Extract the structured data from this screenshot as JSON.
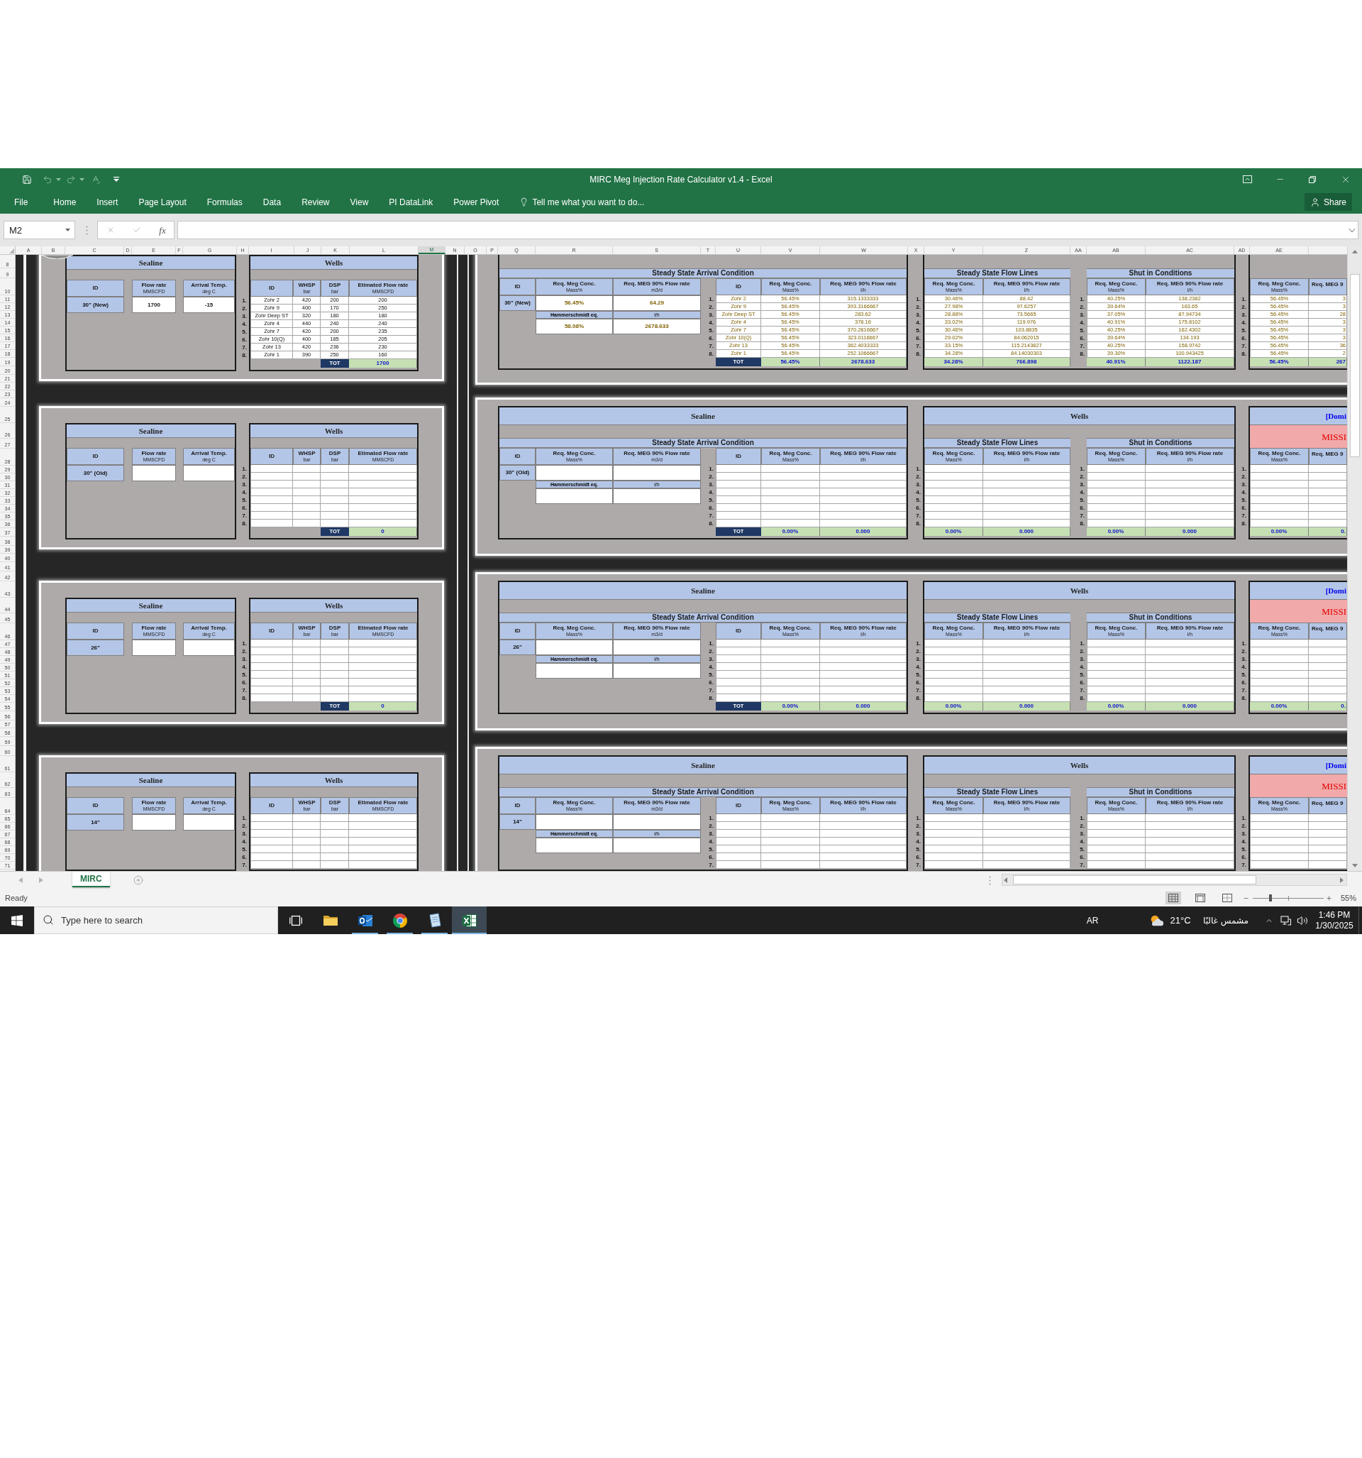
{
  "window": {
    "title": "MIRC Meg Injection Rate Calculator v1.4 - Excel"
  },
  "quick_access": [
    {
      "kind": "save",
      "disabled": false
    },
    {
      "kind": "undo",
      "disabled": true
    },
    {
      "kind": "redo",
      "disabled": true
    },
    {
      "kind": "spelling",
      "disabled": true
    },
    {
      "kind": "customize",
      "disabled": false
    }
  ],
  "ribbon": {
    "tabs": [
      "File",
      "Home",
      "Insert",
      "Page Layout",
      "Formulas",
      "Data",
      "Review",
      "View",
      "PI DataLink",
      "Power Pivot"
    ],
    "tell_me": "Tell me what you want to do...",
    "share": "Share"
  },
  "formula_bar": {
    "name_box": "M2",
    "function_label": "fx"
  },
  "sheet": {
    "columns": [
      {
        "label": "A",
        "selected": false
      },
      {
        "label": "B",
        "selected": false
      },
      {
        "label": "C",
        "selected": false
      },
      {
        "label": "D",
        "selected": false
      },
      {
        "label": "E",
        "selected": false
      },
      {
        "label": "F",
        "selected": false
      },
      {
        "label": "G",
        "selected": false
      },
      {
        "label": "H",
        "selected": false
      },
      {
        "label": "I",
        "selected": false
      },
      {
        "label": "J",
        "selected": false
      },
      {
        "label": "K",
        "selected": false
      },
      {
        "label": "L",
        "selected": false
      },
      {
        "label": "M",
        "selected": true
      },
      {
        "label": "N",
        "selected": false
      },
      {
        "label": "O",
        "selected": false
      },
      {
        "label": "P",
        "selected": false
      },
      {
        "label": "Q",
        "selected": false
      },
      {
        "label": "R",
        "selected": false
      },
      {
        "label": "S",
        "selected": false
      },
      {
        "label": "T",
        "selected": false
      },
      {
        "label": "U",
        "selected": false
      },
      {
        "label": "V",
        "selected": false
      },
      {
        "label": "W",
        "selected": false
      },
      {
        "label": "X",
        "selected": false
      },
      {
        "label": "Y",
        "selected": false
      },
      {
        "label": "Z",
        "selected": false
      },
      {
        "label": "AA",
        "selected": false
      },
      {
        "label": "AB",
        "selected": false
      },
      {
        "label": "AC",
        "selected": false
      },
      {
        "label": "AD",
        "selected": false
      },
      {
        "label": "AE",
        "selected": false
      }
    ],
    "rows": [
      "8",
      "9",
      "10",
      "11",
      "12",
      "13",
      "14",
      "15",
      "16",
      "17",
      "18",
      "19",
      "20",
      "21",
      "22",
      "23",
      "24",
      "25",
      "26",
      "27",
      "28",
      "29",
      "30",
      "31",
      "32",
      "33",
      "34",
      "35",
      "36",
      "37",
      "38",
      "39",
      "40",
      "41",
      "42",
      "43",
      "44",
      "45",
      "46",
      "47",
      "48",
      "49",
      "50",
      "51",
      "52",
      "53",
      "54",
      "55",
      "56",
      "57",
      "58",
      "59",
      "60",
      "61",
      "62",
      "63",
      "64",
      "65",
      "66",
      "67",
      "68",
      "69",
      "70",
      "71"
    ],
    "left_blocks": [
      {
        "sealine": {
          "title": "Sealine",
          "headers": [
            {
              "label": "ID"
            },
            {
              "label": "Flow rate",
              "unit": "MMSCFD"
            },
            {
              "label": "Arrival Temp.",
              "unit": "deg C"
            }
          ],
          "values": [
            "30\" (New)",
            "1700",
            "-15"
          ]
        },
        "wells": {
          "title": "Wells",
          "headers": [
            {
              "label": "ID"
            },
            {
              "label": "WHSP",
              "unit": "bar"
            },
            {
              "label": "DSP",
              "unit": "bar"
            },
            {
              "label": "Etimated Flow rate",
              "unit": "MMSCFD"
            }
          ],
          "rows": [
            {
              "index": "1.",
              "cells": [
                "Zohr 2",
                "420",
                "200",
                "200"
              ]
            },
            {
              "index": "2.",
              "cells": [
                "Zohr 9",
                "400",
                "170",
                "250"
              ]
            },
            {
              "index": "3.",
              "cells": [
                "Zohr Deep ST",
                "320",
                "180",
                "180"
              ]
            },
            {
              "index": "4.",
              "cells": [
                "Zohr 4",
                "440",
                "240",
                "240"
              ]
            },
            {
              "index": "5.",
              "cells": [
                "Zohr 7",
                "420",
                "200",
                "235"
              ]
            },
            {
              "index": "6.",
              "cells": [
                "Zohr 10(Q)",
                "400",
                "185",
                "205"
              ]
            },
            {
              "index": "7.",
              "cells": [
                "Zohr 13",
                "420",
                "236",
                "230"
              ]
            },
            {
              "index": "8.",
              "cells": [
                "Zohr 1",
                "390",
                "250",
                "160"
              ]
            }
          ],
          "total": {
            "label": "TOT",
            "value": "1700"
          }
        }
      },
      {
        "sealine": {
          "title": "Sealine",
          "headers": [
            {
              "label": "ID"
            },
            {
              "label": "Flow rate",
              "unit": "MMSCFD"
            },
            {
              "label": "Arrival Temp.",
              "unit": "deg C"
            }
          ],
          "values": [
            "30\" (Old)"
          ]
        },
        "wells": {
          "title": "Wells",
          "headers": [
            {
              "label": "ID"
            },
            {
              "label": "WHSP",
              "unit": "bar"
            },
            {
              "label": "DSP",
              "unit": "bar"
            },
            {
              "label": "Etimated Flow rate",
              "unit": "MMSCFD"
            }
          ],
          "rows": [
            {
              "index": "1."
            },
            {
              "index": "2."
            },
            {
              "index": "3."
            },
            {
              "index": "4."
            },
            {
              "index": "5."
            },
            {
              "index": "6."
            },
            {
              "index": "7."
            },
            {
              "index": "8."
            }
          ],
          "total": {
            "label": "TOT",
            "value": "0"
          }
        }
      },
      {
        "sealine": {
          "title": "Sealine",
          "headers": [
            {
              "label": "ID"
            },
            {
              "label": "Flow rate",
              "unit": "MMSCFD"
            },
            {
              "label": "Arrival Temp.",
              "unit": "deg C"
            }
          ],
          "values": [
            "26\""
          ]
        },
        "wells": {
          "title": "Wells",
          "headers": [
            {
              "label": "ID"
            },
            {
              "label": "WHSP",
              "unit": "bar"
            },
            {
              "label": "DSP",
              "unit": "bar"
            },
            {
              "label": "Etimated Flow rate",
              "unit": "MMSCFD"
            }
          ],
          "rows": [
            {
              "index": "1."
            },
            {
              "index": "2."
            },
            {
              "index": "3."
            },
            {
              "index": "4."
            },
            {
              "index": "5."
            },
            {
              "index": "6."
            },
            {
              "index": "7."
            },
            {
              "index": "8."
            }
          ],
          "total": {
            "label": "TOT",
            "value": "0"
          }
        }
      },
      {
        "sealine": {
          "title": "Sealine",
          "headers": [
            {
              "label": "ID"
            },
            {
              "label": "Flow rate",
              "unit": "MMSCFD"
            },
            {
              "label": "Arrival Temp.",
              "unit": "deg C"
            }
          ],
          "values": [
            "14\""
          ]
        },
        "wells": {
          "title": "Wells",
          "headers": [
            {
              "label": "ID"
            },
            {
              "label": "WHSP",
              "unit": "bar"
            },
            {
              "label": "DSP",
              "unit": "bar"
            },
            {
              "label": "Etimated Flow rate",
              "unit": "MMSCFD"
            }
          ],
          "rows": [
            {
              "index": "1."
            },
            {
              "index": "2."
            },
            {
              "index": "3."
            },
            {
              "index": "4."
            },
            {
              "index": "5."
            },
            {
              "index": "6."
            },
            {
              "index": "7."
            }
          ]
        }
      }
    ],
    "right_blocks": [
      {
        "sealine": {
          "section": "Steady State Arrival Condition",
          "summary_headers": [
            {
              "label": "ID"
            },
            {
              "label": "Req. Meg Conc.",
              "unit": "Mass%"
            },
            {
              "label": "Req. MEG 90% Flow rate",
              "unit": "m3/d"
            }
          ],
          "summary_values": [
            "30\" (New)",
            "56.45%",
            "64.29"
          ],
          "method": {
            "label": "Hammerschmidt eq.",
            "unit": "l/h",
            "values": [
              "58.08%",
              "2678.633"
            ]
          },
          "well_headers": [
            {
              "label": "ID"
            },
            {
              "label": "Req. Meg Conc.",
              "unit": "Mass%"
            },
            {
              "label": "Req. MEG 90% Flow rate",
              "unit": "l/h"
            }
          ],
          "rows": [
            {
              "index": "1.",
              "cells": [
                "Zohr 2",
                "56.45%",
                "315.1333333"
              ]
            },
            {
              "index": "2.",
              "cells": [
                "Zohr 9",
                "56.45%",
                "393.3166667"
              ]
            },
            {
              "index": "3.",
              "cells": [
                "Zohr Deep ST",
                "56.45%",
                "283.62"
              ]
            },
            {
              "index": "4.",
              "cells": [
                "Zohr 4",
                "56.45%",
                "378.16"
              ]
            },
            {
              "index": "5.",
              "cells": [
                "Zohr 7",
                "56.45%",
                "370.2816667"
              ]
            },
            {
              "index": "6.",
              "cells": [
                "Zohr 10(Q)",
                "56.45%",
                "323.0116667"
              ]
            },
            {
              "index": "7.",
              "cells": [
                "Zohr 13",
                "56.45%",
                "362.4033333"
              ]
            },
            {
              "index": "8.",
              "cells": [
                "Zohr 1",
                "56.45%",
                "252.1066667"
              ]
            }
          ],
          "total": {
            "label": "TOT",
            "values": [
              "56.45%",
              "2678.633"
            ]
          }
        },
        "wells": {
          "sections": [
            {
              "title": "Steady State Flow Lines",
              "headers": [
                {
                  "label": "Req. Meg Conc.",
                  "unit": "Mass%"
                },
                {
                  "label": "Req. MEG 90% Flow rate",
                  "unit": "l/h"
                }
              ],
              "rows": [
                {
                  "index": "1.",
                  "cells": [
                    "30.46%",
                    "88.42"
                  ]
                },
                {
                  "index": "2.",
                  "cells": [
                    "27.98%",
                    "97.6257"
                  ]
                },
                {
                  "index": "3.",
                  "cells": [
                    "28.88%",
                    "73.5665"
                  ]
                },
                {
                  "index": "4.",
                  "cells": [
                    "33.02%",
                    "119.976"
                  ]
                },
                {
                  "index": "5.",
                  "cells": [
                    "30.46%",
                    "103.8835"
                  ]
                },
                {
                  "index": "6.",
                  "cells": [
                    "29.02%",
                    "84.062015"
                  ]
                },
                {
                  "index": "7.",
                  "cells": [
                    "33.15%",
                    "115.2143827"
                  ]
                },
                {
                  "index": "8.",
                  "cells": [
                    "34.28%",
                    "84.14030303"
                  ]
                }
              ],
              "totals": [
                "34.28%",
                "766.898"
              ]
            },
            {
              "title": "Shut in Conditions",
              "headers": [
                {
                  "label": "Req. Meg Conc.",
                  "unit": "Mass%"
                },
                {
                  "label": "Req. MEG 90% Flow rate",
                  "unit": "l/h"
                }
              ],
              "rows": [
                {
                  "index": "1.",
                  "cells": [
                    "40.25%",
                    "138.2382"
                  ]
                },
                {
                  "index": "2.",
                  "cells": [
                    "39.64%",
                    "163.65"
                  ]
                },
                {
                  "index": "3.",
                  "cells": [
                    "37.05%",
                    "87.94734"
                  ]
                },
                {
                  "index": "4.",
                  "cells": [
                    "40.91%",
                    "175.8102"
                  ]
                },
                {
                  "index": "5.",
                  "cells": [
                    "40.25%",
                    "162.4302"
                  ]
                },
                {
                  "index": "6.",
                  "cells": [
                    "39.64%",
                    "134.193"
                  ]
                },
                {
                  "index": "7.",
                  "cells": [
                    "40.25%",
                    "158.9742"
                  ]
                },
                {
                  "index": "8.",
                  "cells": [
                    "39.30%",
                    "100.943425"
                  ]
                }
              ],
              "totals": [
                "40.91%",
                "1122.187"
              ]
            }
          ]
        },
        "extra": {
          "headers": [
            {
              "label": "Req. Meg Conc.",
              "unit": "Mass%"
            },
            {
              "label": "Req. MEG 9"
            }
          ],
          "rows": [
            {
              "index": "1.",
              "cells": [
                "56.45%",
                "3"
              ]
            },
            {
              "index": "2.",
              "cells": [
                "56.45%",
                "3"
              ]
            },
            {
              "index": "3.",
              "cells": [
                "56.45%",
                "28"
              ]
            },
            {
              "index": "4.",
              "cells": [
                "56.45%",
                "3"
              ]
            },
            {
              "index": "5.",
              "cells": [
                "56.45%",
                "3"
              ]
            },
            {
              "index": "6.",
              "cells": [
                "56.45%",
                "3"
              ]
            },
            {
              "index": "7.",
              "cells": [
                "56.45%",
                "36"
              ]
            },
            {
              "index": "8.",
              "cells": [
                "56.45%",
                "2"
              ]
            }
          ],
          "totals": [
            "56.45%",
            "267"
          ]
        }
      },
      {
        "sealine": {
          "title": "Sealine",
          "section": "Steady State Arrival Condition",
          "summary_headers": [
            {
              "label": "ID"
            },
            {
              "label": "Req. Meg Conc.",
              "unit": "Mass%"
            },
            {
              "label": "Req. MEG 90% Flow rate",
              "unit": "m3/d"
            }
          ],
          "summary_values": [
            "30\" (Old)"
          ],
          "method": {
            "label": "Hammerschmidt eq.",
            "unit": "l/h"
          },
          "well_headers": [
            {
              "label": "ID"
            },
            {
              "label": "Req. Meg Conc.",
              "unit": "Mass%"
            },
            {
              "label": "Req. MEG 90% Flow rate",
              "unit": "l/h"
            }
          ],
          "rows": [
            {
              "index": "1."
            },
            {
              "index": "2."
            },
            {
              "index": "3."
            },
            {
              "index": "4."
            },
            {
              "index": "5."
            },
            {
              "index": "6."
            },
            {
              "index": "7."
            },
            {
              "index": "8."
            }
          ],
          "total": {
            "label": "TOT",
            "values": [
              "0.00%",
              "0.000"
            ]
          }
        },
        "wells": {
          "title": "Wells",
          "sections": [
            {
              "title": "Steady State Flow Lines",
              "headers": [
                {
                  "label": "Req. Meg Conc.",
                  "unit": "Mass%"
                },
                {
                  "label": "Req. MEG 90% Flow rate",
                  "unit": "l/h"
                }
              ],
              "rows": [
                {
                  "index": "1."
                },
                {
                  "index": "2."
                },
                {
                  "index": "3."
                },
                {
                  "index": "4."
                },
                {
                  "index": "5."
                },
                {
                  "index": "6."
                },
                {
                  "index": "7."
                },
                {
                  "index": "8."
                }
              ],
              "totals": [
                "0.00%",
                "0.000"
              ]
            },
            {
              "title": "Shut in Conditions",
              "headers": [
                {
                  "label": "Req. Meg Conc.",
                  "unit": "Mass%"
                },
                {
                  "label": "Req. MEG 90% Flow rate",
                  "unit": "l/h"
                }
              ],
              "rows": [
                {
                  "index": "1."
                },
                {
                  "index": "2."
                },
                {
                  "index": "3."
                },
                {
                  "index": "4."
                },
                {
                  "index": "5."
                },
                {
                  "index": "6."
                },
                {
                  "index": "7."
                },
                {
                  "index": "8."
                }
              ],
              "totals": [
                "0.00%",
                "0.000"
              ]
            }
          ]
        },
        "extra": {
          "title": "[Domi",
          "warning": "MISSI",
          "headers": [
            {
              "label": "Req. Meg Conc.",
              "unit": "Mass%"
            },
            {
              "label": "Req. MEG 9"
            }
          ],
          "rows": [
            {
              "index": "1."
            },
            {
              "index": "2."
            },
            {
              "index": "3."
            },
            {
              "index": "4."
            },
            {
              "index": "5."
            },
            {
              "index": "6."
            },
            {
              "index": "7."
            },
            {
              "index": "8."
            }
          ],
          "totals": [
            "0.00%",
            "0."
          ]
        }
      },
      {
        "sealine": {
          "title": "Sealine",
          "section": "Steady State Arrival Condition",
          "summary_headers": [
            {
              "label": "ID"
            },
            {
              "label": "Req. Meg Conc.",
              "unit": "Mass%"
            },
            {
              "label": "Req. MEG 90% Flow rate",
              "unit": "m3/d"
            }
          ],
          "summary_values": [
            "26\""
          ],
          "method": {
            "label": "Hammerschmidt eq.",
            "unit": "l/h"
          },
          "well_headers": [
            {
              "label": "ID"
            },
            {
              "label": "Req. Meg Conc.",
              "unit": "Mass%"
            },
            {
              "label": "Req. MEG 90% Flow rate",
              "unit": "l/h"
            }
          ],
          "rows": [
            {
              "index": "1."
            },
            {
              "index": "2."
            },
            {
              "index": "3."
            },
            {
              "index": "4."
            },
            {
              "index": "5."
            },
            {
              "index": "6."
            },
            {
              "index": "7."
            },
            {
              "index": "8."
            }
          ],
          "total": {
            "label": "TOT",
            "values": [
              "0.00%",
              "0.000"
            ]
          }
        },
        "wells": {
          "title": "Wells",
          "sections": [
            {
              "title": "Steady State Flow Lines",
              "headers": [
                {
                  "label": "Req. Meg Conc.",
                  "unit": "Mass%"
                },
                {
                  "label": "Req. MEG 90% Flow rate",
                  "unit": "l/h"
                }
              ],
              "rows": [
                {
                  "index": "1."
                },
                {
                  "index": "2."
                },
                {
                  "index": "3."
                },
                {
                  "index": "4."
                },
                {
                  "index": "5."
                },
                {
                  "index": "6."
                },
                {
                  "index": "7."
                },
                {
                  "index": "8."
                }
              ],
              "totals": [
                "0.00%",
                "0.000"
              ]
            },
            {
              "title": "Shut in Conditions",
              "headers": [
                {
                  "label": "Req. Meg Conc.",
                  "unit": "Mass%"
                },
                {
                  "label": "Req. MEG 90% Flow rate",
                  "unit": "l/h"
                }
              ],
              "rows": [
                {
                  "index": "1."
                },
                {
                  "index": "2."
                },
                {
                  "index": "3."
                },
                {
                  "index": "4."
                },
                {
                  "index": "5."
                },
                {
                  "index": "6."
                },
                {
                  "index": "7."
                },
                {
                  "index": "8."
                }
              ],
              "totals": [
                "0.00%",
                "0.000"
              ]
            }
          ]
        },
        "extra": {
          "title": "[Domi",
          "warning": "MISSI",
          "headers": [
            {
              "label": "Req. Meg Conc.",
              "unit": "Mass%"
            },
            {
              "label": "Req. MEG 9"
            }
          ],
          "rows": [
            {
              "index": "1."
            },
            {
              "index": "2."
            },
            {
              "index": "3."
            },
            {
              "index": "4."
            },
            {
              "index": "5."
            },
            {
              "index": "6."
            },
            {
              "index": "7."
            },
            {
              "index": "8."
            }
          ],
          "totals": [
            "0.00%",
            "0."
          ]
        }
      },
      {
        "sealine": {
          "title": "Sealine",
          "section": "Steady State Arrival Condition",
          "summary_headers": [
            {
              "label": "ID"
            },
            {
              "label": "Req. Meg Conc.",
              "unit": "Mass%"
            },
            {
              "label": "Req. MEG 90% Flow rate",
              "unit": "m3/d"
            }
          ],
          "summary_values": [
            "14\""
          ],
          "method": {
            "label": "Hammerschmidt eq.",
            "unit": "l/h"
          },
          "well_headers": [
            {
              "label": "ID"
            },
            {
              "label": "Req. Meg Conc.",
              "unit": "Mass%"
            },
            {
              "label": "Req. MEG 90% Flow rate",
              "unit": "l/h"
            }
          ],
          "rows": [
            {
              "index": "1."
            },
            {
              "index": "2."
            },
            {
              "index": "3."
            },
            {
              "index": "4."
            },
            {
              "index": "5."
            },
            {
              "index": "6."
            },
            {
              "index": "7."
            }
          ]
        },
        "wells": {
          "title": "Wells",
          "sections": [
            {
              "title": "Steady State Flow Lines",
              "headers": [
                {
                  "label": "Req. Meg Conc.",
                  "unit": "Mass%"
                },
                {
                  "label": "Req. MEG 90% Flow rate",
                  "unit": "l/h"
                }
              ],
              "rows": [
                {
                  "index": "1."
                },
                {
                  "index": "2."
                },
                {
                  "index": "3."
                },
                {
                  "index": "4."
                },
                {
                  "index": "5."
                },
                {
                  "index": "6."
                },
                {
                  "index": "7."
                }
              ]
            },
            {
              "title": "Shut in Conditions",
              "headers": [
                {
                  "label": "Req. Meg Conc.",
                  "unit": "Mass%"
                },
                {
                  "label": "Req. MEG 90% Flow rate",
                  "unit": "l/h"
                }
              ],
              "rows": [
                {
                  "index": "1."
                },
                {
                  "index": "2."
                },
                {
                  "index": "3."
                },
                {
                  "index": "4."
                },
                {
                  "index": "5."
                },
                {
                  "index": "6."
                },
                {
                  "index": "7."
                }
              ]
            }
          ]
        },
        "extra": {
          "title": "[Domi",
          "warning": "MISSI",
          "headers": [
            {
              "label": "Req. Meg Conc.",
              "unit": "Mass%"
            },
            {
              "label": "Req. MEG 9"
            }
          ],
          "rows": [
            {
              "index": "1."
            },
            {
              "index": "2."
            },
            {
              "index": "3."
            },
            {
              "index": "4."
            },
            {
              "index": "5."
            },
            {
              "index": "6."
            },
            {
              "index": "7."
            }
          ]
        }
      }
    ]
  },
  "sheet_tabs": [
    {
      "label": "MIRC",
      "selected": true
    }
  ],
  "status_bar": {
    "status": "Ready",
    "views": [
      {
        "kind": "normal",
        "selected": true
      },
      {
        "kind": "page_layout",
        "selected": false
      },
      {
        "kind": "page_break",
        "selected": false
      }
    ],
    "zoom_slider": {
      "level": 0.25
    },
    "zoom": "55%"
  },
  "taskbar": {
    "search_placeholder": "Type here to search",
    "apps": [
      {
        "kind": "task_view",
        "running": false,
        "selected": false
      },
      {
        "kind": "folder",
        "running": false,
        "selected": false
      },
      {
        "kind": "mail",
        "running": true,
        "selected": false
      },
      {
        "kind": "round",
        "running": true,
        "selected": false
      },
      {
        "kind": "document",
        "running": true,
        "selected": false
      },
      {
        "kind": "spreadsheet",
        "running": true,
        "selected": true
      }
    ],
    "language": "AR",
    "temperature": "21°C",
    "weather": "مشمس غالبًا",
    "time": "1:46 PM",
    "date": "1/30/2025"
  }
}
